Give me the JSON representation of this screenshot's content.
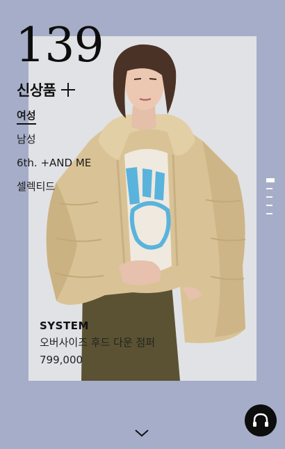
{
  "hero": {
    "count": "139",
    "category_title": "신상품"
  },
  "menu": {
    "items": [
      {
        "label": "여성",
        "active": true
      },
      {
        "label": "남성",
        "active": false
      },
      {
        "label": "6th. +AND ME",
        "active": false
      },
      {
        "label": "셀렉티드",
        "active": false
      }
    ]
  },
  "product": {
    "brand": "SYSTEM",
    "name": "오버사이즈 후드 다운 점퍼",
    "price": "799,000"
  },
  "pager": {
    "total": 5,
    "current": 1
  },
  "icons": {
    "plus": "plus-icon",
    "scroll_down": "chevron-down-icon",
    "support": "headset-icon"
  },
  "colors": {
    "background": "#a6adc8",
    "accent": "#0d0d0d"
  }
}
